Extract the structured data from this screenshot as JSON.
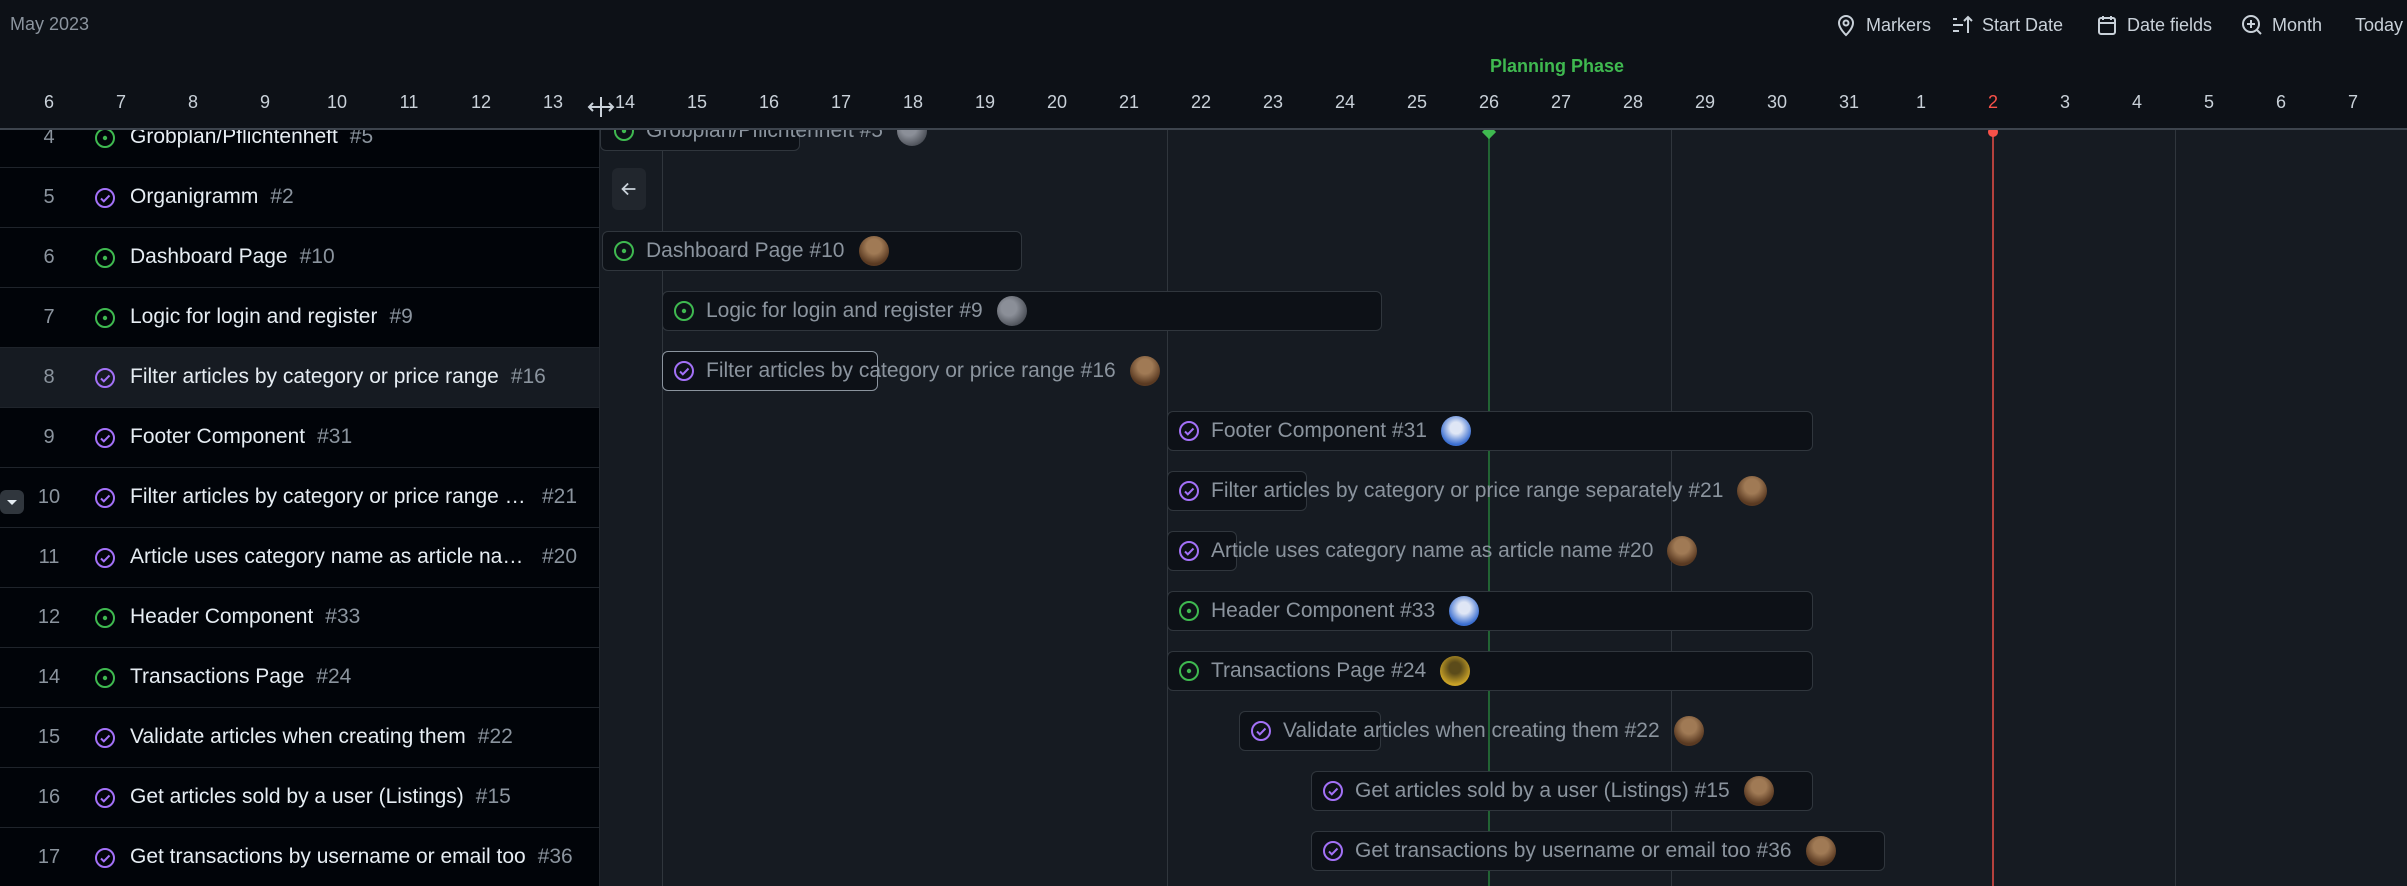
{
  "header": {
    "month": "May 2023",
    "phase": "Planning Phase"
  },
  "toolbar": {
    "markers": "Markers",
    "sort": "Start Date",
    "date_fields": "Date fields",
    "zoom": "Month",
    "today": "Today"
  },
  "days": [
    "6",
    "7",
    "8",
    "9",
    "10",
    "11",
    "12",
    "13",
    "14",
    "15",
    "16",
    "17",
    "18",
    "19",
    "20",
    "21",
    "22",
    "23",
    "24",
    "25",
    "26",
    "27",
    "28",
    "29",
    "30",
    "31",
    "1",
    "2",
    "3",
    "4",
    "5",
    "6",
    "7"
  ],
  "today_day": "2",
  "rows": [
    {
      "num": "4",
      "title": "Grobplan/Pflichtenheft",
      "ref": "#5",
      "status": "open"
    },
    {
      "num": "5",
      "title": "Organigramm",
      "ref": "#2",
      "status": "closed"
    },
    {
      "num": "6",
      "title": "Dashboard Page",
      "ref": "#10",
      "status": "open"
    },
    {
      "num": "7",
      "title": "Logic for login and register",
      "ref": "#9",
      "status": "open"
    },
    {
      "num": "8",
      "title": "Filter articles by category or price range",
      "ref": "#16",
      "status": "closed"
    },
    {
      "num": "9",
      "title": "Footer Component",
      "ref": "#31",
      "status": "closed"
    },
    {
      "num": "10",
      "title": "Filter articles by category or price range s...",
      "ref": "#21",
      "status": "closed"
    },
    {
      "num": "11",
      "title": "Article uses category name as article name",
      "ref": "#20",
      "status": "closed"
    },
    {
      "num": "12",
      "title": "Header Component",
      "ref": "#33",
      "status": "open"
    },
    {
      "num": "14",
      "title": "Transactions Page",
      "ref": "#24",
      "status": "open"
    },
    {
      "num": "15",
      "title": "Validate articles when creating them",
      "ref": "#22",
      "status": "closed"
    },
    {
      "num": "16",
      "title": "Get articles sold by a user (Listings)",
      "ref": "#15",
      "status": "closed"
    },
    {
      "num": "17",
      "title": "Get transactions by username or email too",
      "ref": "#36",
      "status": "closed"
    }
  ],
  "bars": [
    {
      "label": "Grobplan/Pflichtenheft #5",
      "status": "open",
      "avatar": "gray"
    },
    {
      "label": "",
      "status": "none",
      "avatar": ""
    },
    {
      "label": "Dashboard Page #10",
      "status": "open",
      "avatar": "brown"
    },
    {
      "label": "Logic for login and register #9",
      "status": "open",
      "avatar": "gray"
    },
    {
      "label": "Filter articles by category or price range #16",
      "status": "closed",
      "avatar": "brown"
    },
    {
      "label": "Footer Component #31",
      "status": "closed",
      "avatar": "blue"
    },
    {
      "label": "Filter articles by category or price range separately #21",
      "status": "closed",
      "avatar": "brown"
    },
    {
      "label": "Article uses category name as article name #20",
      "status": "closed",
      "avatar": "brown"
    },
    {
      "label": "Header Component #33",
      "status": "open",
      "avatar": "blue"
    },
    {
      "label": "Transactions Page #24",
      "status": "open",
      "avatar": "yellow"
    },
    {
      "label": "Validate articles when creating them #22",
      "status": "closed",
      "avatar": "brown"
    },
    {
      "label": "Get articles sold by a user (Listings) #15",
      "status": "closed",
      "avatar": "brown"
    },
    {
      "label": "Get transactions by username or email too #36",
      "status": "closed",
      "avatar": "brown"
    }
  ],
  "colors": {
    "open": "#3fb950",
    "closed": "#a371f7",
    "today": "#f85149",
    "phase": "#3fb950"
  }
}
